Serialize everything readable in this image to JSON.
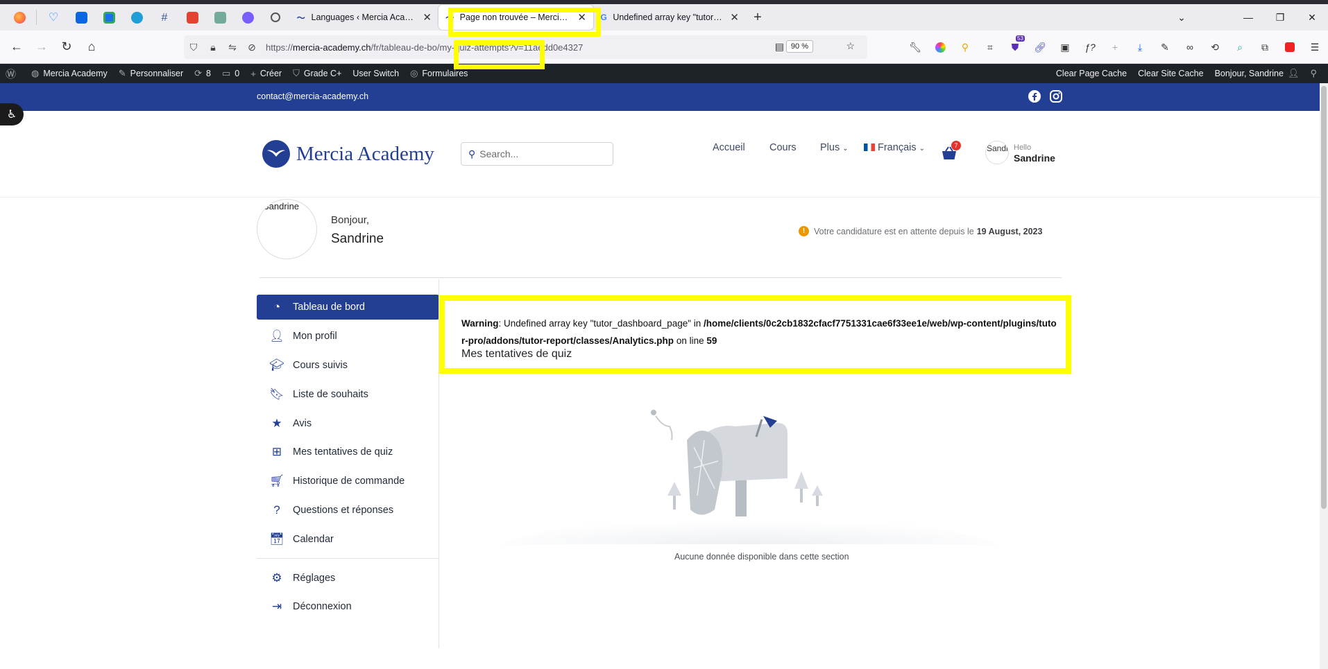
{
  "browser": {
    "tabs": [
      {
        "title": "Languages ‹ Mercia Academy — ",
        "active": false
      },
      {
        "title": "Page non trouvée – Mercia Academy",
        "active": true
      },
      {
        "title": "Undefined array key \"tutor_dashboard_page\"",
        "active": false
      }
    ],
    "url": {
      "scheme": "https://",
      "host": "mercia-academy.ch",
      "path": "/fr/tableau-de-bo",
      "path_highlight": "/my-quiz-attempts",
      "query": "?v=11aedd0e4327"
    },
    "zoom": "90 %",
    "extension_badge": "53"
  },
  "adminbar": {
    "items": [
      "Mercia Academy",
      "Personnaliser",
      "8",
      "0",
      "Créer",
      "Grade C+",
      "User Switch",
      "Formulaires"
    ],
    "right": [
      "Clear Page Cache",
      "Clear Site Cache",
      "Bonjour, Sandrine"
    ]
  },
  "topbar": {
    "email": "contact@mercia-academy.ch"
  },
  "header": {
    "logo": "Mercia Academy",
    "search_placeholder": "Search...",
    "menu": [
      "Accueil",
      "Cours",
      "Plus",
      "Français"
    ],
    "cart_count": "7",
    "avatar_text": "Sandrine",
    "hello": "Hello",
    "user": "Sandrine"
  },
  "dashboard": {
    "avatar_text": "Sandrine",
    "greeting": "Bonjour,",
    "name": "Sandrine",
    "pending_text": "Votre candidature est en attente depuis le",
    "pending_date": "19 August, 2023",
    "sidebar": [
      {
        "label": "Tableau de bord",
        "icon": "dashboard-icon",
        "active": true
      },
      {
        "label": "Mon profil",
        "icon": "user-icon"
      },
      {
        "label": "Cours suivis",
        "icon": "graduation-cap-icon"
      },
      {
        "label": "Liste de souhaits",
        "icon": "bookmark-icon"
      },
      {
        "label": "Avis",
        "icon": "star-icon"
      },
      {
        "label": "Mes tentatives de quiz",
        "icon": "quiz-icon"
      },
      {
        "label": "Historique de commande",
        "icon": "cart-icon"
      },
      {
        "label": "Questions et réponses",
        "icon": "qa-icon"
      },
      {
        "label": "Calendar",
        "icon": "calendar-icon"
      },
      {
        "label": "Réglages",
        "icon": "gear-icon"
      },
      {
        "label": "Déconnexion",
        "icon": "logout-icon"
      }
    ],
    "warning": {
      "label": "Warning",
      "text1": ": Undefined array key \"tutor_dashboard_page\" in ",
      "path": "/home/clients/0c2cb1832cfacf7751331cae6f33ee1e/web/wp-content/plugins/tutor-pro/addons/tutor-report/classes/Analytics.php",
      "text2": " on line ",
      "line": "59"
    },
    "section_title": "Mes tentatives de quiz",
    "empty_text": "Aucune donnée disponible dans cette section"
  },
  "colors": {
    "brand": "#233f94",
    "highlight": "#ffff00",
    "admin_bar": "#1d2327"
  }
}
